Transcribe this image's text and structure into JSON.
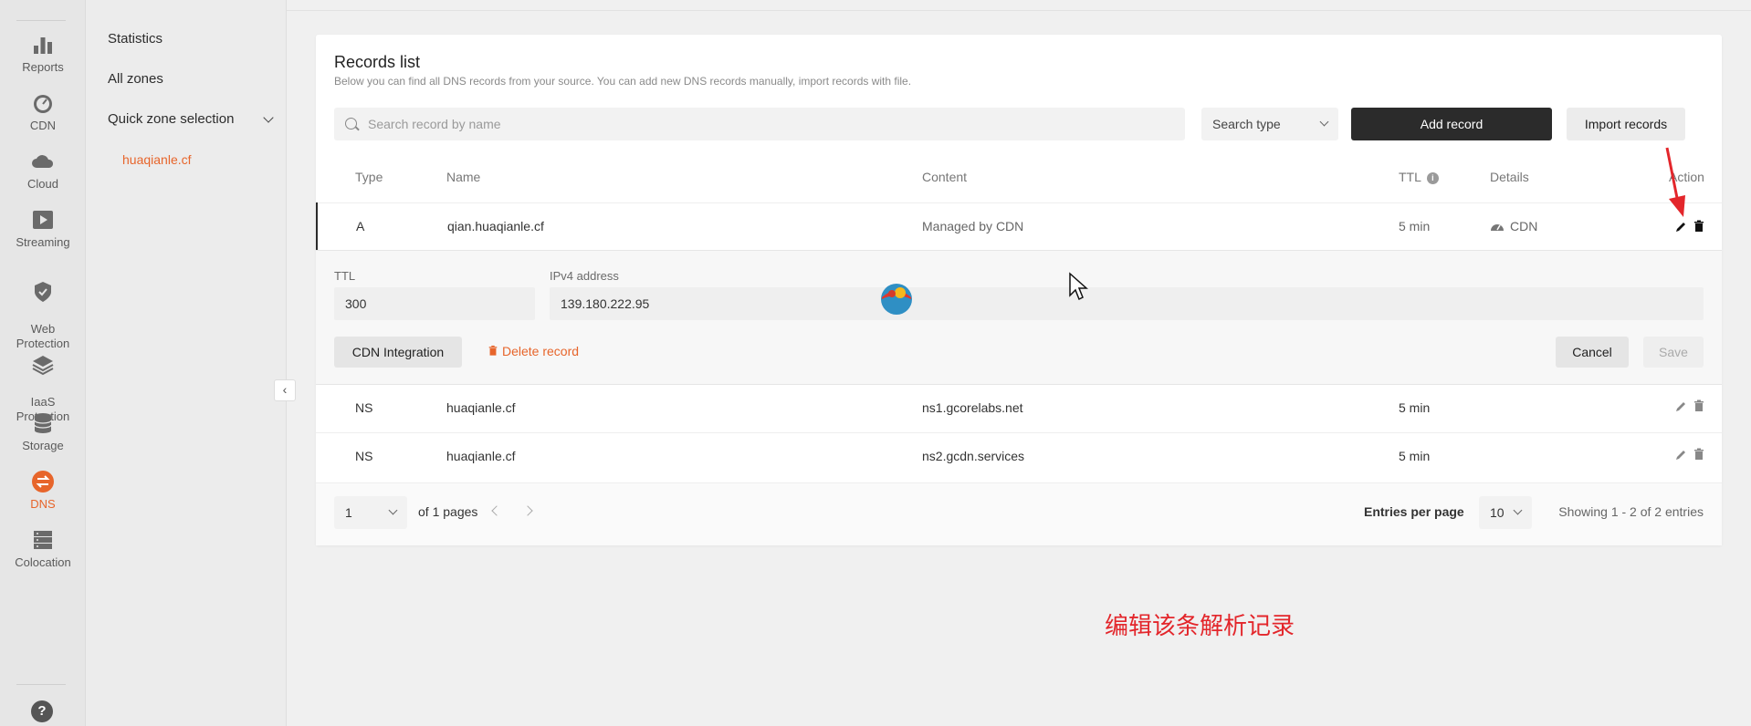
{
  "rail": {
    "items": [
      {
        "label": "Reports",
        "icon": "bar-chart-icon"
      },
      {
        "label": "CDN",
        "icon": "speedometer-icon"
      },
      {
        "label": "Cloud",
        "icon": "cloud-icon"
      },
      {
        "label": "Streaming",
        "icon": "play-icon"
      },
      {
        "label": "Web\nProtection",
        "icon": "shield-icon"
      },
      {
        "label": "IaaS\nProtection",
        "icon": "layers-icon"
      },
      {
        "label": "Storage",
        "icon": "database-icon"
      },
      {
        "label": "DNS",
        "icon": "swap-arrows-icon"
      },
      {
        "label": "Colocation",
        "icon": "server-rack-icon"
      }
    ],
    "active": "DNS",
    "help": "?"
  },
  "sidebar": {
    "statistics": "Statistics",
    "all_zones": "All zones",
    "quick_zone": "Quick zone selection",
    "zone": "huaqianle.cf"
  },
  "card": {
    "title": "Records list",
    "subtitle": "Below you can find all DNS records from your source. You can add new DNS records manually, import records with file."
  },
  "toolbar": {
    "search_placeholder": "Search record by name",
    "search_type": "Search type",
    "add_record": "Add record",
    "import_records": "Import records"
  },
  "table": {
    "headers": {
      "type": "Type",
      "name": "Name",
      "content": "Content",
      "ttl": "TTL",
      "details": "Details",
      "action": "Action"
    },
    "rows": [
      {
        "type": "A",
        "name": "qian.huaqianle.cf",
        "content": "Managed by CDN",
        "ttl": "5 min",
        "details": "CDN"
      },
      {
        "type": "NS",
        "name": "huaqianle.cf",
        "content": "ns1.gcorelabs.net",
        "ttl": "5 min",
        "details": ""
      },
      {
        "type": "NS",
        "name": "huaqianle.cf",
        "content": "ns2.gcdn.services",
        "ttl": "5 min",
        "details": ""
      }
    ]
  },
  "edit": {
    "ttl_label": "TTL",
    "ttl_value": "300",
    "ipv4_label": "IPv4 address",
    "ipv4_value": "139.180.222.95",
    "cdn_integration": "CDN Integration",
    "delete_record": "Delete record",
    "cancel": "Cancel",
    "save": "Save"
  },
  "pagination": {
    "page": "1",
    "of_pages": "of 1 pages",
    "entries_label": "Entries per page",
    "entries_value": "10",
    "showing": "Showing 1 - 2 of 2 entries"
  },
  "annotation": {
    "caption": "编辑该条解析记录",
    "color": "#e3262b"
  },
  "colors": {
    "accent": "#e7652b",
    "dark_button": "#2b2b2b"
  }
}
